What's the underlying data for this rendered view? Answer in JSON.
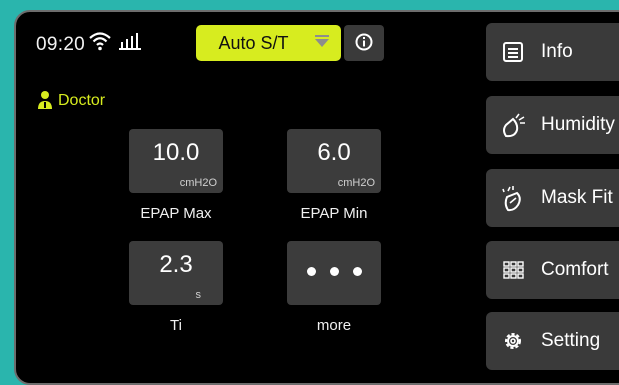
{
  "status": {
    "time": "09:20"
  },
  "mode": {
    "label": "Auto S/T",
    "accent": "#d7ec1f"
  },
  "user": {
    "role": "Doctor"
  },
  "params": [
    {
      "value": "10.0",
      "unit": "cmH2O",
      "label": "EPAP Max"
    },
    {
      "value": "6.0",
      "unit": "cmH2O",
      "label": "EPAP Min"
    },
    {
      "value": "2.3",
      "unit": "s",
      "label": "Ti"
    },
    {
      "label": "more"
    }
  ],
  "menu": [
    {
      "label": "Info",
      "icon": "list-icon"
    },
    {
      "label": "Humidity",
      "icon": "humidity-icon"
    },
    {
      "label": "Mask Fit",
      "icon": "mask-icon"
    },
    {
      "label": "Comfort",
      "icon": "grid-icon"
    },
    {
      "label": "Setting",
      "icon": "gear-icon"
    }
  ],
  "colors": {
    "background": "#2ab5ad",
    "screen": "#000000",
    "tile": "#3c3c3c"
  }
}
